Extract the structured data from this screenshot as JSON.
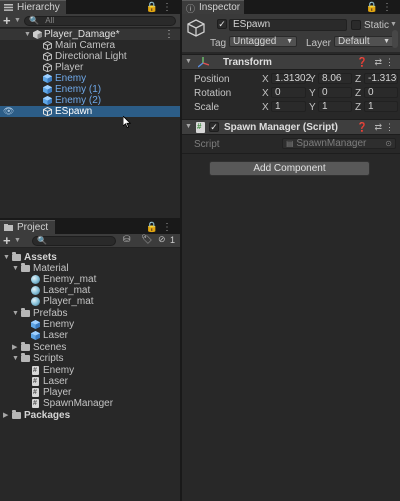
{
  "hierarchy": {
    "tab_label": "Hierarchy",
    "search_placeholder": "All",
    "scene_name": "Player_Damage*",
    "items": [
      {
        "label": "Main Camera",
        "icon": "gameobject-icon"
      },
      {
        "label": "Directional Light",
        "icon": "gameobject-icon"
      },
      {
        "label": "Player",
        "icon": "gameobject-icon"
      },
      {
        "label": "Enemy",
        "icon": "prefab-icon"
      },
      {
        "label": "Enemy (1)",
        "icon": "prefab-icon"
      },
      {
        "label": "Enemy (2)",
        "icon": "prefab-icon"
      },
      {
        "label": "ESpawn",
        "icon": "gameobject-icon"
      }
    ]
  },
  "project": {
    "tab_label": "Project",
    "search_placeholder": "",
    "hidden_count": "1",
    "tree": {
      "assets": "Assets",
      "material": "Material",
      "materials": [
        "Enemy_mat",
        "Laser_mat",
        "Player_mat"
      ],
      "prefabs": "Prefabs",
      "prefab_items": [
        "Enemy",
        "Laser"
      ],
      "scenes": "Scenes",
      "scripts": "Scripts",
      "script_items": [
        "Enemy",
        "Laser",
        "Player",
        "SpawnManager"
      ],
      "packages": "Packages"
    }
  },
  "inspector": {
    "tab_label": "Inspector",
    "object_name": "ESpawn",
    "static_label": "Static",
    "tag_label": "Tag",
    "tag_value": "Untagged",
    "layer_label": "Layer",
    "layer_value": "Default",
    "transform": {
      "title": "Transform",
      "position_label": "Position",
      "rotation_label": "Rotation",
      "scale_label": "Scale",
      "axis_x": "X",
      "axis_y": "Y",
      "axis_z": "Z",
      "position": {
        "x": "1.31302",
        "y": "8.06",
        "z": "-1.3130"
      },
      "rotation": {
        "x": "0",
        "y": "0",
        "z": "0"
      },
      "scale": {
        "x": "1",
        "y": "1",
        "z": "1"
      }
    },
    "spawn_manager": {
      "title": "Spawn Manager (Script)",
      "script_label": "Script",
      "script_value": "SpawnManager"
    },
    "add_component": "Add Component"
  },
  "colors": {
    "selection": "#2c5d87",
    "prefab_text": "#6fa8e8",
    "panel_bg": "#282828"
  }
}
